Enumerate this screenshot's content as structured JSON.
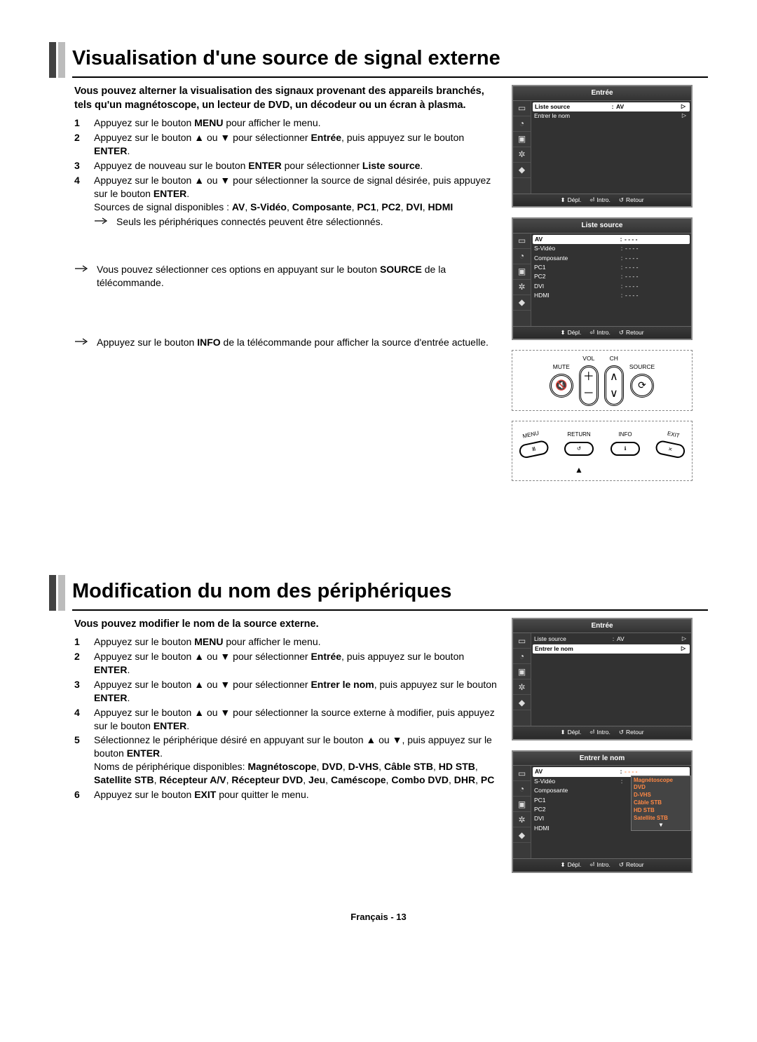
{
  "section1": {
    "title": "Visualisation d'une source de signal externe",
    "intro": "Vous pouvez alterner la visualisation des signaux provenant des appareils branchés, tels qu'un magnétoscope, un lecteur de DVD, un décodeur ou un écran à plasma.",
    "step1_num": "1",
    "step1": "Appuyez sur le bouton <b>MENU</b> pour afficher le menu.",
    "step2_num": "2",
    "step2": "Appuyez sur le bouton ▲ ou ▼ pour sélectionner <b>Entrée</b>, puis appuyez sur le bouton <b>ENTER</b>.",
    "step3_num": "3",
    "step3": "Appuyez de nouveau sur le bouton <b>ENTER</b> pour sélectionner <b>Liste source</b>.",
    "step4_num": "4",
    "step4a": "Appuyez sur le bouton ▲ ou ▼ pour sélectionner la source de signal désirée, puis appuyez sur le bouton <b>ENTER</b>.",
    "step4b": "Sources de signal disponibles : <b>AV</b>, <b>S-Vidéo</b>, <b>Composante</b>, <b>PC1</b>, <b>PC2</b>, <b>DVI</b>, <b>HDMI</b>",
    "note1": "Seuls les périphériques connectés peuvent être sélectionnés.",
    "note2": "Vous pouvez sélectionner ces options en appuyant sur le bouton <b>SOURCE</b> de la télécommande.",
    "note3": "Appuyez sur le bouton <b>INFO</b> de la télécommande pour afficher la source d'entrée actuelle."
  },
  "section2": {
    "title": "Modification du nom des périphériques",
    "intro": "Vous pouvez modifier le nom de la source externe.",
    "step1_num": "1",
    "step1": "Appuyez sur le bouton <b>MENU</b> pour afficher le menu.",
    "step2_num": "2",
    "step2": "Appuyez sur le bouton ▲ ou ▼ pour sélectionner <b>Entrée</b>, puis appuyez sur le bouton <b>ENTER</b>.",
    "step3_num": "3",
    "step3": "Appuyez sur le bouton ▲ ou ▼ pour sélectionner <b>Entrer le nom</b>, puis appuyez sur le bouton <b>ENTER</b>.",
    "step4_num": "4",
    "step4": "Appuyez sur le bouton ▲ ou ▼ pour sélectionner la source externe à modifier, puis appuyez sur le bouton <b>ENTER</b>.",
    "step5_num": "5",
    "step5a": "Sélectionnez le périphérique désiré en appuyant sur le bouton ▲ ou ▼, puis appuyez sur le bouton <b>ENTER</b>.",
    "step5b": "Noms de périphérique disponibles: <b>Magnétoscope</b>, <b>DVD</b>, <b>D-VHS</b>, <b>Câble STB</b>, <b>HD STB</b>, <b>Satellite STB</b>, <b>Récepteur A/V</b>, <b>Récepteur DVD</b>, <b>Jeu</b>, <b>Caméscope</b>, <b>Combo DVD</b>, <b>DHR</b>, <b>PC</b>",
    "step6_num": "6",
    "step6": "Appuyez sur le bouton <b>EXIT</b> pour quitter le menu."
  },
  "osd": {
    "entree": "Entrée",
    "liste_source": "Liste source",
    "entrer_nom": "Entrer le nom",
    "av": "AV",
    "svideo": "S-Vidéo",
    "composante": "Composante",
    "pc1": "PC1",
    "pc2": "PC2",
    "dvi": "DVI",
    "hdmi": "HDMI",
    "dashes": "- - - -",
    "depl": "Dépl.",
    "intro_btn": "Intro.",
    "retour": "Retour",
    "dd_magneto": "Magnétoscope",
    "dd_dvd": "DVD",
    "dd_dvhs": "D-VHS",
    "dd_cable": "Câble STB",
    "dd_hd": "HD STB",
    "dd_sat": "Satellite STB"
  },
  "remote": {
    "vol": "VOL",
    "ch": "CH",
    "mute": "MUTE",
    "source": "SOURCE",
    "return": "RETURN",
    "info": "INFO",
    "menu": "MENU",
    "exit": "EXIT"
  },
  "footer": "Français - 13"
}
